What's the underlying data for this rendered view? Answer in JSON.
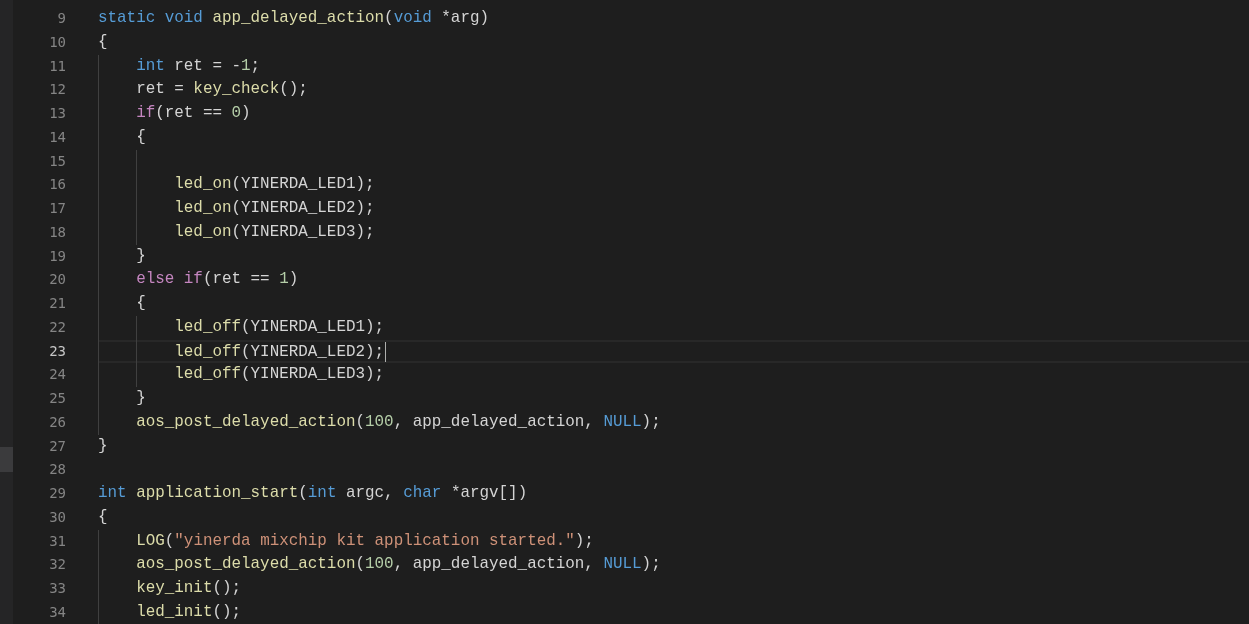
{
  "editor": {
    "lines": [
      {
        "number": "9",
        "current": false,
        "tokens": [
          {
            "kind": "keyword",
            "text": "static void"
          },
          {
            "kind": "function",
            "text": " app_delayed_action"
          },
          {
            "kind": "plain",
            "text": "("
          },
          {
            "kind": "keyword",
            "text": "void"
          },
          {
            "kind": "plain",
            "text": " *arg)"
          }
        ]
      },
      {
        "number": "10",
        "current": false,
        "tokens": [
          {
            "kind": "plain",
            "text": "{"
          }
        ]
      },
      {
        "number": "11",
        "current": false,
        "tokens": [
          {
            "kind": "keyword",
            "text": "    int"
          },
          {
            "kind": "plain",
            "text": " ret = -"
          },
          {
            "kind": "number",
            "text": "1"
          },
          {
            "kind": "plain",
            "text": ";"
          }
        ]
      },
      {
        "number": "12",
        "current": false,
        "tokens": [
          {
            "kind": "plain",
            "text": "    ret = "
          },
          {
            "kind": "function",
            "text": "key_check"
          },
          {
            "kind": "plain",
            "text": "();"
          }
        ]
      },
      {
        "number": "13",
        "current": false,
        "tokens": [
          {
            "kind": "control",
            "text": "    if"
          },
          {
            "kind": "plain",
            "text": "(ret == "
          },
          {
            "kind": "number",
            "text": "0"
          },
          {
            "kind": "plain",
            "text": ")"
          }
        ]
      },
      {
        "number": "14",
        "current": false,
        "tokens": [
          {
            "kind": "plain",
            "text": "    {"
          }
        ]
      },
      {
        "number": "15",
        "current": false
      },
      {
        "number": "16",
        "current": false,
        "tokens": [
          {
            "kind": "function",
            "text": "        led_on"
          },
          {
            "kind": "plain",
            "text": "(YINERDA_LED1);"
          }
        ]
      },
      {
        "number": "17",
        "current": false,
        "tokens": [
          {
            "kind": "function",
            "text": "        led_on"
          },
          {
            "kind": "plain",
            "text": "(YINERDA_LED2);"
          }
        ]
      },
      {
        "number": "18",
        "current": false,
        "tokens": [
          {
            "kind": "function",
            "text": "        led_on"
          },
          {
            "kind": "plain",
            "text": "(YINERDA_LED3);"
          }
        ]
      },
      {
        "number": "19",
        "current": false,
        "tokens": [
          {
            "kind": "plain",
            "text": "    }"
          }
        ]
      },
      {
        "number": "20",
        "current": false,
        "tokens": [
          {
            "kind": "control",
            "text": "    else if"
          },
          {
            "kind": "plain",
            "text": "(ret == "
          },
          {
            "kind": "number",
            "text": "1"
          },
          {
            "kind": "plain",
            "text": ")"
          }
        ]
      },
      {
        "number": "21",
        "current": false,
        "tokens": [
          {
            "kind": "plain",
            "text": "    {"
          }
        ]
      },
      {
        "number": "22",
        "current": false,
        "tokens": [
          {
            "kind": "function",
            "text": "        led_off"
          },
          {
            "kind": "plain",
            "text": "(YINERDA_LED1);"
          }
        ]
      },
      {
        "number": "23",
        "current": true,
        "tokens": [
          {
            "kind": "function",
            "text": "        led_off"
          },
          {
            "kind": "plain",
            "text": "(YINERDA_LED2);"
          }
        ]
      },
      {
        "number": "24",
        "current": false,
        "tokens": [
          {
            "kind": "function",
            "text": "        led_off"
          },
          {
            "kind": "plain",
            "text": "(YINERDA_LED3);"
          }
        ]
      },
      {
        "number": "25",
        "current": false,
        "tokens": [
          {
            "kind": "plain",
            "text": "    }"
          }
        ]
      },
      {
        "number": "26",
        "current": false,
        "tokens": [
          {
            "kind": "function",
            "text": "    aos_post_delayed_action"
          },
          {
            "kind": "plain",
            "text": "("
          },
          {
            "kind": "number",
            "text": "100"
          },
          {
            "kind": "plain",
            "text": ", app_delayed_action, "
          },
          {
            "kind": "keyword",
            "text": "NULL"
          },
          {
            "kind": "plain",
            "text": ");"
          }
        ]
      },
      {
        "number": "27",
        "current": false,
        "tokens": [
          {
            "kind": "plain",
            "text": "}"
          }
        ]
      },
      {
        "number": "28",
        "current": false
      },
      {
        "number": "29",
        "current": false,
        "tokens": [
          {
            "kind": "keyword",
            "text": "int"
          },
          {
            "kind": "function",
            "text": " application_start"
          },
          {
            "kind": "plain",
            "text": "("
          },
          {
            "kind": "keyword",
            "text": "int"
          },
          {
            "kind": "plain",
            "text": " argc, "
          },
          {
            "kind": "keyword",
            "text": "char"
          },
          {
            "kind": "plain",
            "text": " *argv[])"
          }
        ]
      },
      {
        "number": "30",
        "current": false,
        "tokens": [
          {
            "kind": "plain",
            "text": "{"
          }
        ]
      },
      {
        "number": "31",
        "current": false,
        "tokens": [
          {
            "kind": "function",
            "text": "    LOG"
          },
          {
            "kind": "plain",
            "text": "("
          },
          {
            "kind": "string",
            "text": "\"yinerda mixchip kit application started.\""
          },
          {
            "kind": "plain",
            "text": ");"
          }
        ]
      },
      {
        "number": "32",
        "current": false,
        "tokens": [
          {
            "kind": "function",
            "text": "    aos_post_delayed_action"
          },
          {
            "kind": "plain",
            "text": "("
          },
          {
            "kind": "number",
            "text": "100"
          },
          {
            "kind": "plain",
            "text": ", app_delayed_action, "
          },
          {
            "kind": "keyword",
            "text": "NULL"
          },
          {
            "kind": "plain",
            "text": ");"
          }
        ]
      },
      {
        "number": "33",
        "current": false,
        "tokens": [
          {
            "kind": "function",
            "text": "    key_init"
          },
          {
            "kind": "plain",
            "text": "();"
          }
        ]
      },
      {
        "number": "34",
        "current": false,
        "tokens": [
          {
            "kind": "function",
            "text": "    led_init"
          },
          {
            "kind": "plain",
            "text": "();"
          }
        ]
      }
    ]
  }
}
